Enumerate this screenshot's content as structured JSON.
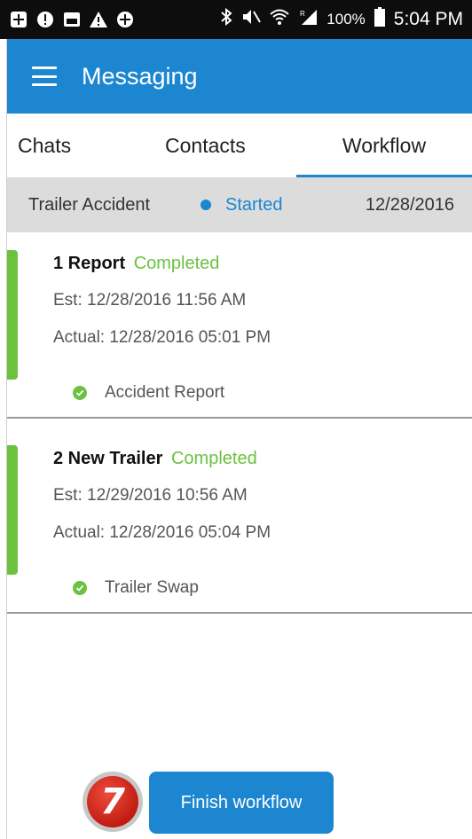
{
  "status_bar": {
    "battery": "100%",
    "time": "5:04 PM",
    "left_icons": [
      "plus-square-icon",
      "alert-circle-icon",
      "image-icon",
      "warning-icon",
      "plus-circle-icon"
    ],
    "right_icons": [
      "bluetooth-icon",
      "mute-icon",
      "wifi-icon",
      "signal-icon",
      "battery-icon"
    ]
  },
  "app_bar": {
    "title": "Messaging"
  },
  "tabs": [
    {
      "label": "Chats"
    },
    {
      "label": "Contacts"
    },
    {
      "label": "Workflow",
      "active": true
    }
  ],
  "workflow": {
    "name": "Trailer Accident",
    "status": "Started",
    "date": "12/28/2016"
  },
  "steps": [
    {
      "title": "1 Report",
      "state": "Completed",
      "est": "Est: 12/28/2016 11:56 AM",
      "actual": "Actual: 12/28/2016 05:01 PM",
      "task": "Accident Report"
    },
    {
      "title": "2 New Trailer",
      "state": "Completed",
      "est": "Est: 12/29/2016 10:56 AM",
      "actual": "Actual: 12/28/2016 05:04 PM",
      "task": "Trailer Swap"
    }
  ],
  "annotation_badge": "7",
  "finish_button": "Finish workflow",
  "colors": {
    "primary": "#1c86d1",
    "completed": "#6cc13f",
    "header_bg": "#dcdcdc"
  }
}
